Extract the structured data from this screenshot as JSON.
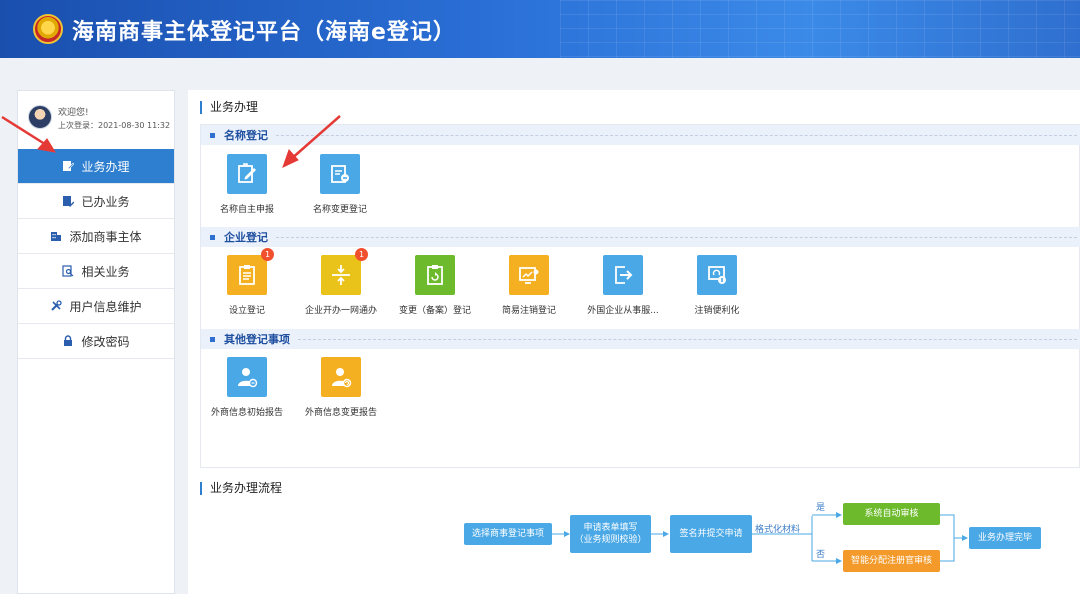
{
  "header": {
    "title": "海南商事主体登记平台（海南e登记）"
  },
  "user": {
    "welcome": "欢迎您!",
    "last_login": "上次登录：2021-08-30 11:32"
  },
  "sidebar": {
    "items": [
      {
        "label": "业务办理",
        "icon": "edit-icon",
        "active": true
      },
      {
        "label": "已办业务",
        "icon": "document-check-icon"
      },
      {
        "label": "添加商事主体",
        "icon": "building-icon"
      },
      {
        "label": "相关业务",
        "icon": "search-document-icon"
      },
      {
        "label": "用户信息维护",
        "icon": "tools-icon"
      },
      {
        "label": "修改密码",
        "icon": "lock-icon"
      }
    ]
  },
  "main": {
    "section_title": "业务办理",
    "categories": [
      {
        "label": "名称登记",
        "items": [
          {
            "label": "名称自主申报",
            "color": "#4aa8e6",
            "icon": "edit-form-icon"
          },
          {
            "label": "名称变更登记",
            "color": "#4aa8e6",
            "icon": "clipboard-minus-icon"
          }
        ]
      },
      {
        "label": "企业登记",
        "items": [
          {
            "label": "设立登记",
            "color": "#f5b021",
            "icon": "clipboard-list-icon",
            "badge": "1"
          },
          {
            "label": "企业开办一网通办",
            "color": "#e9c21a",
            "icon": "merge-arrows-icon",
            "badge": "1"
          },
          {
            "label": "变更（备案）登记",
            "color": "#6dbb2c",
            "icon": "clipboard-refresh-icon"
          },
          {
            "label": "简易注销登记",
            "color": "#f5b021",
            "icon": "chart-screen-icon"
          },
          {
            "label": "外国企业从事服...",
            "color": "#4aa8e6",
            "icon": "exit-arrow-icon"
          },
          {
            "label": "注销便利化",
            "color": "#4aa8e6",
            "icon": "screen-refresh-icon"
          }
        ]
      },
      {
        "label": "其他登记事项",
        "items": [
          {
            "label": "外商信息初始报告",
            "color": "#4aa8e6",
            "icon": "user-report-icon"
          },
          {
            "label": "外商信息变更报告",
            "color": "#f5b021",
            "icon": "user-change-icon"
          }
        ]
      }
    ]
  },
  "flow": {
    "title": "业务办理流程",
    "step1": "选择商事登记事项",
    "step2_line1": "申请表单填写",
    "step2_line2": "（业务规则校验）",
    "step3": "签名并提交申请",
    "middle_label": "格式化材料",
    "yes_label": "是",
    "no_label": "否",
    "auto_review": "系统自动审核",
    "manual_review": "智能分配注册官审核",
    "done": "业务办理完毕"
  }
}
